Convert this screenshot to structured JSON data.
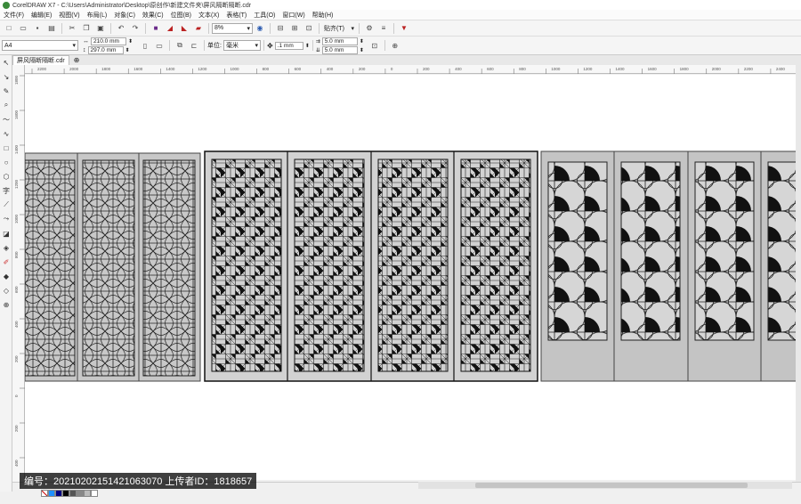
{
  "window": {
    "title": "CorelDRAW X7 - C:\\Users\\Administrator\\Desktop\\原创作\\新建文件夹\\屏风隔断隔断.cdr"
  },
  "menu": [
    "文件(F)",
    "编辑(E)",
    "视图(V)",
    "布局(L)",
    "对象(C)",
    "效果(C)",
    "位图(B)",
    "文本(X)",
    "表格(T)",
    "工具(O)",
    "窗口(W)",
    "帮助(H)"
  ],
  "toolbar": {
    "zoom": "8%",
    "snap_label": "贴齐(T)"
  },
  "propertybar": {
    "page_size": "A4",
    "width": "210.0 mm",
    "height": "297.0 mm",
    "units_label": "单位:",
    "units": "毫米",
    "nudge": ".1 mm",
    "dup_x": "5.0 mm",
    "dup_y": "5.0 mm"
  },
  "document": {
    "tab_label": "屏风隔断隔断.cdr"
  },
  "ruler": {
    "h_ticks": [
      "2200",
      "2000",
      "1800",
      "1600",
      "1400",
      "1200",
      "1000",
      "800",
      "600",
      "400",
      "200",
      "0",
      "200",
      "400",
      "600",
      "800",
      "1000",
      "1200",
      "1400",
      "1600",
      "1800",
      "2000",
      "2200",
      "2400"
    ],
    "v_ticks": [
      "1800",
      "1600",
      "1400",
      "1200",
      "1000",
      "800",
      "600",
      "400",
      "200",
      "0",
      "200",
      "400"
    ]
  },
  "footer": {
    "watermark": "编号：20210202151421063070 上传者ID：1818657"
  },
  "palette": [
    "#ffffff",
    "#1e90ff",
    "#000080",
    "#000000",
    "#555555",
    "#888888",
    "#bbbbbb",
    "#ffffff"
  ],
  "colors": {
    "panel_gray": "#c8c8c8",
    "frame": "#222222"
  }
}
